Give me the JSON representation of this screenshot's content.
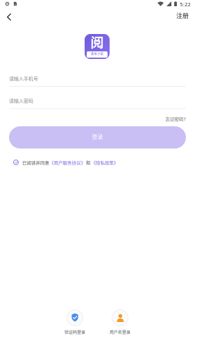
{
  "status_bar": {
    "time": "5:22",
    "icons": [
      "settings-icon",
      "sim-icon",
      "wifi-icon",
      "signal-icon",
      "battery-icon"
    ]
  },
  "nav": {
    "back_icon": "chevron-left-icon",
    "register_label": "注册"
  },
  "logo": {
    "char": "阅",
    "subtitle": "爱米小说",
    "color": "#6d5cd9"
  },
  "form": {
    "phone_placeholder": "请输入手机号",
    "password_placeholder": "请输入密码",
    "forgot_label": "忘记密码?",
    "login_label": "登录",
    "login_button_color": "#c9bff5"
  },
  "agreement": {
    "prefix": "已阅读并同意",
    "service_link": "《用户服务协议》",
    "and": "和",
    "privacy_link": "《隐私政策》",
    "link_color": "#7d6be0"
  },
  "alt_login": {
    "sms_label": "验证码登录",
    "user_label": "用户名登录",
    "sms_icon": "shield-check-icon",
    "user_icon": "user-icon"
  }
}
